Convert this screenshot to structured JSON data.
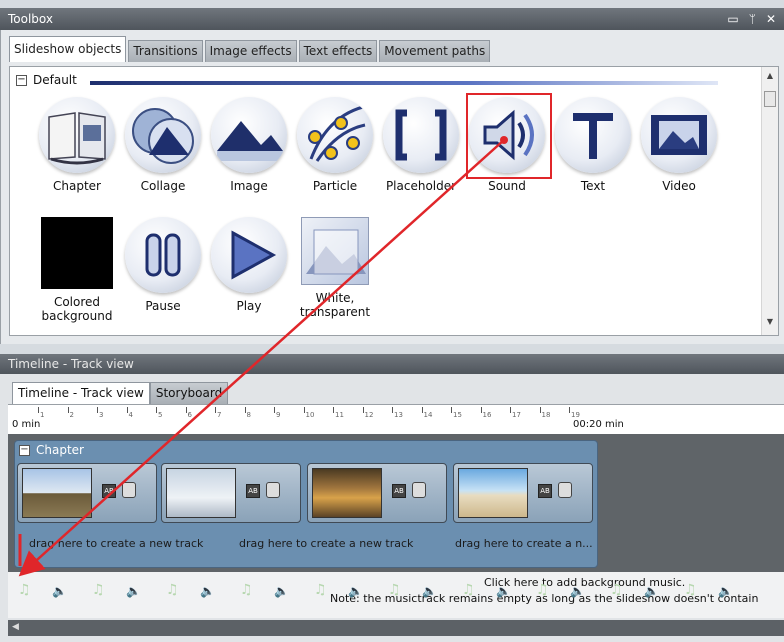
{
  "toolbox": {
    "title": "Toolbox",
    "window_controls": [
      "▭",
      "ᛘ",
      "✕"
    ],
    "tabs": [
      "Slideshow objects",
      "Transitions",
      "Image effects",
      "Text effects",
      "Movement paths"
    ],
    "group_label": "Default",
    "objects": [
      {
        "label": "Chapter",
        "icon": "book-icon"
      },
      {
        "label": "Collage",
        "icon": "collage-icon"
      },
      {
        "label": "Image",
        "icon": "image-icon"
      },
      {
        "label": "Particle",
        "icon": "particle-icon"
      },
      {
        "label": "Placeholder",
        "icon": "placeholder-icon"
      },
      {
        "label": "Sound",
        "icon": "speaker-icon"
      },
      {
        "label": "Text",
        "icon": "text-icon"
      },
      {
        "label": "Video",
        "icon": "film-icon"
      },
      {
        "label": "Colored background",
        "label_lines": [
          "Colored",
          "background"
        ],
        "icon": "black-square-icon"
      },
      {
        "label": "Pause",
        "icon": "pause-icon"
      },
      {
        "label": "Play",
        "icon": "play-icon"
      },
      {
        "label": "White, transparent",
        "label_lines": [
          "White,",
          "transparent"
        ],
        "icon": "white-transparent-icon"
      }
    ]
  },
  "timeline": {
    "title": "Timeline - Track view",
    "tabs": [
      "Timeline - Track view",
      "Storyboard"
    ],
    "ruler_start": "0 min",
    "ruler_end": "00:20 min",
    "ruler_ticks": [
      "1",
      "2",
      "3",
      "4",
      "5",
      "6",
      "7",
      "8",
      "9",
      "10",
      "11",
      "12",
      "13",
      "14",
      "15",
      "16",
      "17",
      "18",
      "19"
    ],
    "chapter_label": "Chapter",
    "drag_hints": [
      "drag here to create a new track",
      "drag here to create a new track",
      "drag here to create a n..."
    ],
    "music_line1": "Click here to add background music.",
    "music_line2": "Note: the musictrack remains empty as long as the slideshow doesn't contain"
  },
  "colors": {
    "accent_red": "#e0262a",
    "title_bar": "#5f656b"
  }
}
